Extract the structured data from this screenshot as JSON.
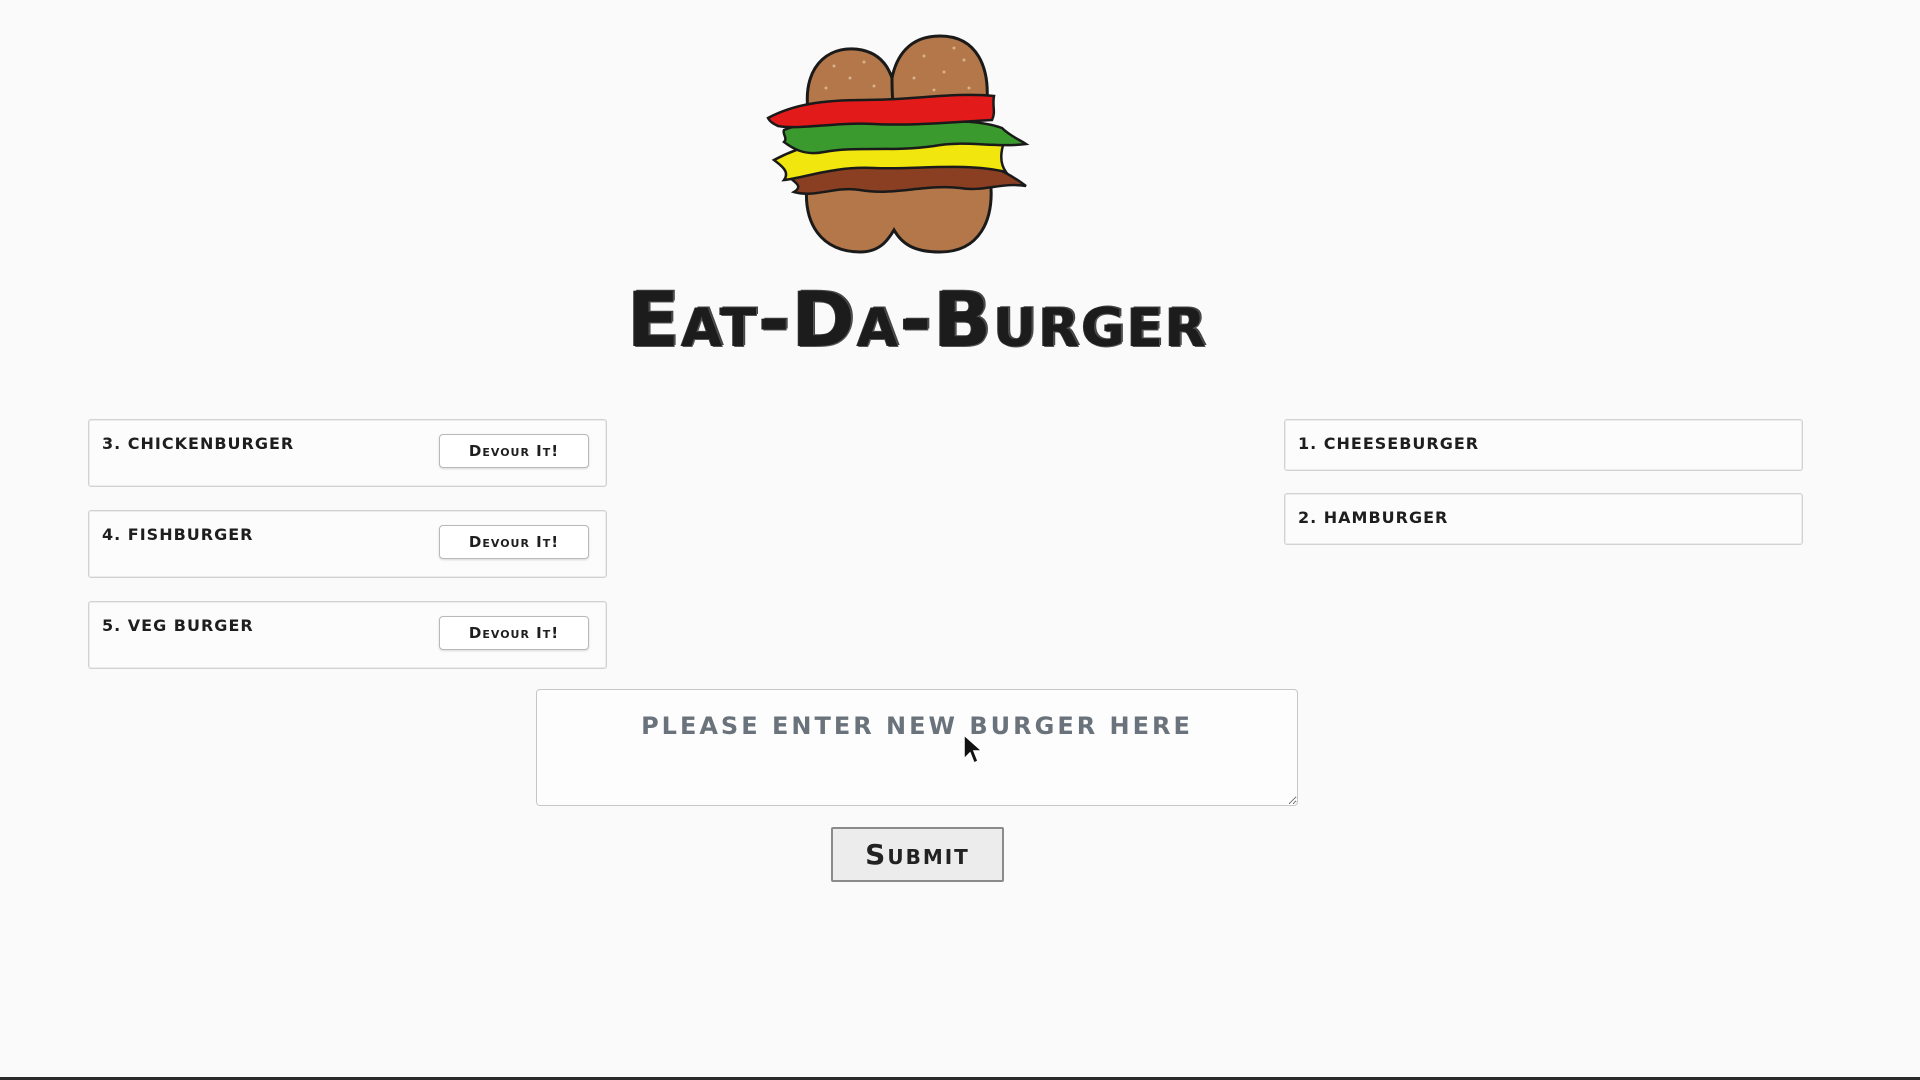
{
  "header": {
    "logo_icon": "burger-logo-icon",
    "title": "Eat-Da-Burger"
  },
  "left_column": {
    "items": [
      {
        "label": "3. chickenburger",
        "button_label": "Devour It!"
      },
      {
        "label": "4. fishburger",
        "button_label": "Devour It!"
      },
      {
        "label": "5. veg burger",
        "button_label": "Devour It!"
      }
    ]
  },
  "right_column": {
    "items": [
      {
        "label": "1. cheeseburger"
      },
      {
        "label": "2. hamburger"
      }
    ]
  },
  "form": {
    "input_value": "",
    "input_placeholder": "please enter new burger here",
    "submit_label": "Submit"
  },
  "colors": {
    "bun": "#b3774a",
    "tomato": "#e21a1a",
    "lettuce": "#3a9a2e",
    "cheese": "#f2e60f",
    "patty": "#8a3e22",
    "outline": "#1a1a1a"
  }
}
